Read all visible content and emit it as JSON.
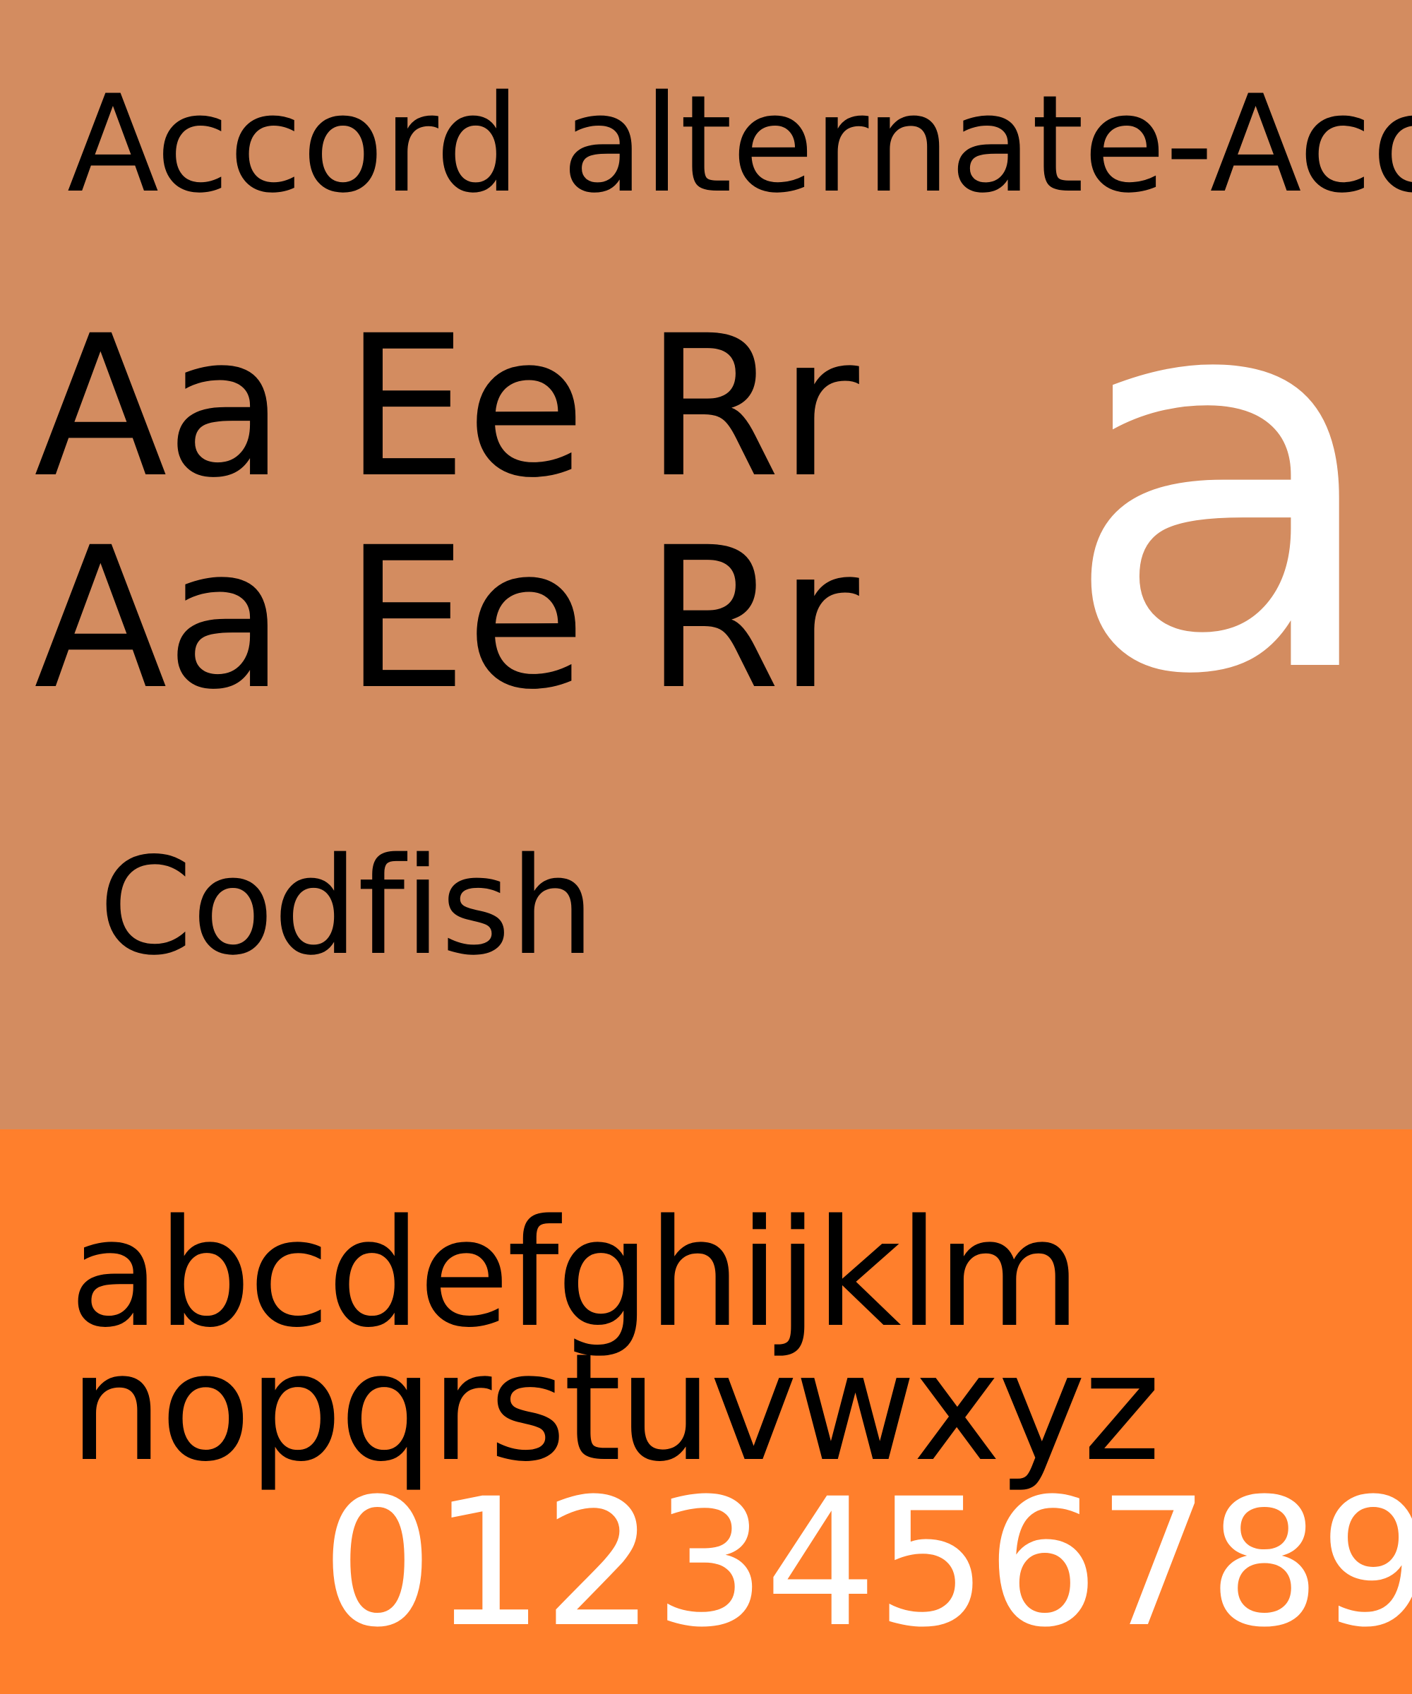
{
  "colors": {
    "top_background": "#d38c60",
    "bottom_background": "#ff7f2c",
    "text": "#000000",
    "highlight_text": "#ffffff"
  },
  "specimen": {
    "title": "Accord alternate-Accord",
    "sample_line_1": "Aa Ee Rr",
    "sample_line_2": "Aa Ee Rr",
    "showcase_letter": "a",
    "sample_word": "Codfish"
  },
  "character_set": {
    "lowercase_line_1": "abcdefghijklm",
    "lowercase_line_2": "nopqrstuvwxyz",
    "numerals": "0123456789"
  }
}
